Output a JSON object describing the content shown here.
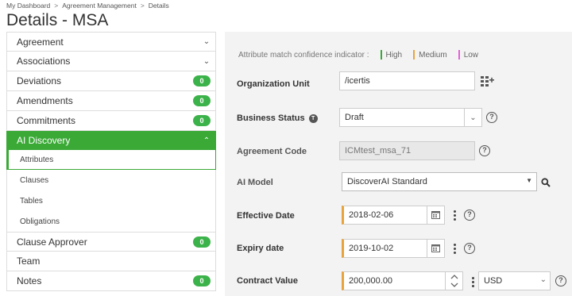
{
  "breadcrumb": {
    "items": [
      "My Dashboard",
      "Agreement Management",
      "Details"
    ],
    "separator": ">"
  },
  "page_title": "Details - MSA",
  "sidebar": {
    "items": [
      {
        "label": "Agreement",
        "chevron": "⌄"
      },
      {
        "label": "Associations",
        "chevron": "⌄"
      },
      {
        "label": "Deviations",
        "badge": "0"
      },
      {
        "label": "Amendments",
        "badge": "0"
      },
      {
        "label": "Commitments",
        "badge": "0"
      },
      {
        "label": "AI Discovery",
        "chevron": "⌃"
      },
      {
        "label": "Clause Approver",
        "badge": "0"
      },
      {
        "label": "Team"
      },
      {
        "label": "Notes",
        "badge": "0"
      }
    ],
    "ai_discovery_subitems": [
      "Attributes",
      "Clauses",
      "Tables",
      "Obligations"
    ]
  },
  "confidence": {
    "label": "Attribute match confidence indicator :",
    "levels": [
      {
        "name": "High",
        "color": "#3aa936"
      },
      {
        "name": "Medium",
        "color": "#e8a33d"
      },
      {
        "name": "Low",
        "color": "#e45fd6"
      }
    ]
  },
  "fields": {
    "org_unit": {
      "label": "Organization Unit",
      "value": "/icertis"
    },
    "business_status": {
      "label": "Business Status",
      "info": "T",
      "value": "Draft"
    },
    "agreement_code": {
      "label": "Agreement Code",
      "value": "ICMtest_msa_71"
    },
    "ai_model": {
      "label": "AI Model",
      "value": "DiscoverAI Standard"
    },
    "effective_date": {
      "label": "Effective Date",
      "value": "2018-02-06"
    },
    "expiry_date": {
      "label": "Expiry date",
      "value": "2019-10-02"
    },
    "contract_value": {
      "label": "Contract Value",
      "value": "200,000.00",
      "currency": "USD"
    }
  },
  "icons": {
    "help": "?",
    "dropdown": "⌄",
    "dropdown_solid": "▼"
  },
  "colors": {
    "accent_green": "#3aa936",
    "badge_green": "#3cb34a",
    "medium_orange": "#e8a33d",
    "low_pink": "#e45fd6"
  }
}
